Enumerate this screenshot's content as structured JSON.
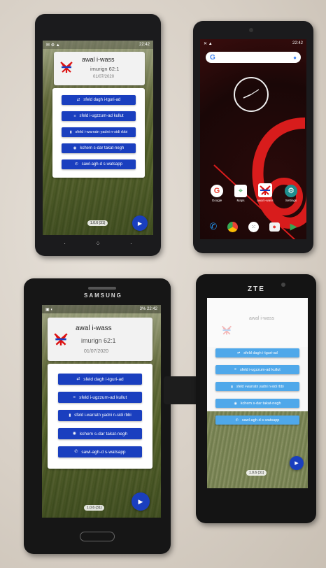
{
  "app": {
    "title": "awal i-wass",
    "subtitle": "imurign 62:1",
    "date": "01/07/2020",
    "version": "1.0.6 (31)",
    "accent": "#1a3fbf",
    "menu": [
      {
        "icon": "shuffle-icon",
        "glyph": "⇄",
        "label": "sfeld dagh i-tguri-ad"
      },
      {
        "icon": "list-icon",
        "glyph": "≡",
        "label": "sfeld i-ugzzum-ad kullut"
      },
      {
        "icon": "book-icon",
        "glyph": "▮",
        "label": "sfeld i-warratn yadni n-sidi rbbi"
      },
      {
        "icon": "globe-icon",
        "glyph": "◉",
        "label": "kchem s-dar takat-negh"
      },
      {
        "icon": "whatsapp-icon",
        "glyph": "✆",
        "label": "sawl-agh-d s-watsapp"
      }
    ]
  },
  "phone1": {
    "time": "22:42"
  },
  "phone2": {
    "time": "22:42",
    "search_g": "G",
    "apps": [
      "Google",
      "Maps",
      "awal i-wass",
      "Settings"
    ]
  },
  "phone3": {
    "brand": "SAMSUNG",
    "status": "3%  22:42"
  },
  "phone4": {
    "brand": "ZTE"
  }
}
